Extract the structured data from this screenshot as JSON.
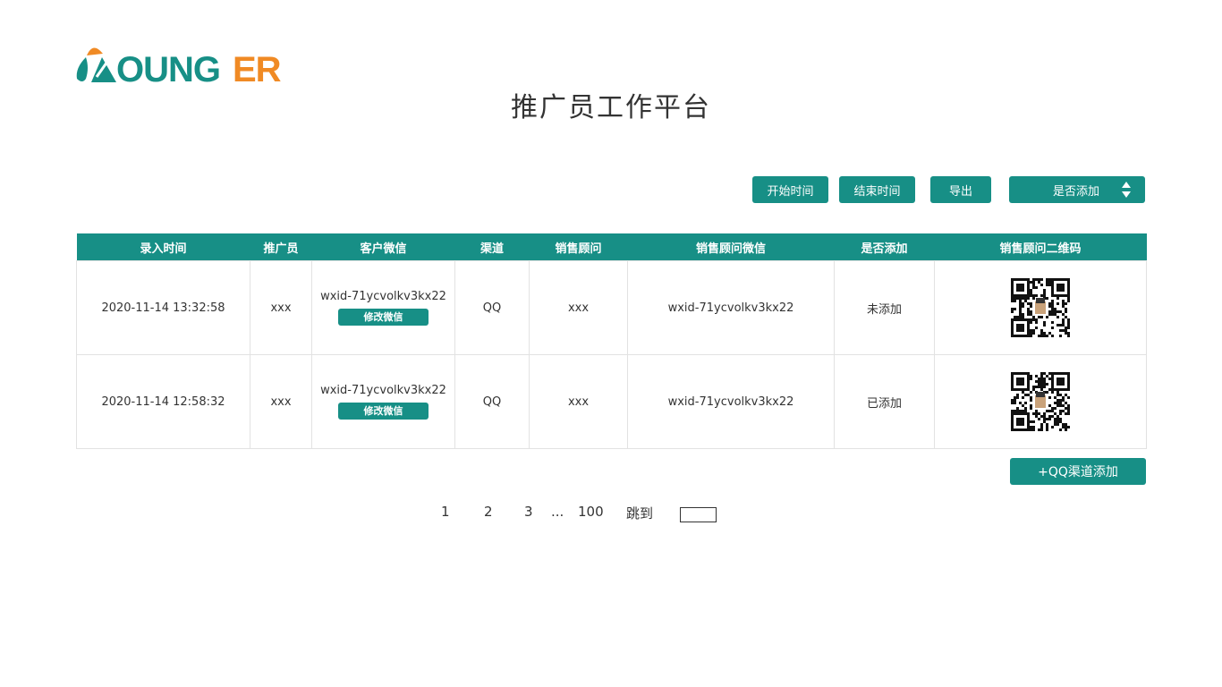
{
  "brand": {
    "logo_text": "OUNGER",
    "teal": "#178f86",
    "orange": "#f08a24"
  },
  "page_title": "推广员工作平台",
  "toolbar": {
    "start_time": "开始时间",
    "end_time": "结束时间",
    "export": "导出",
    "added_filter": "是否添加"
  },
  "table": {
    "headers": [
      "录入时间",
      "推广员",
      "客户微信",
      "渠道",
      "销售顾问",
      "销售顾问微信",
      "是否添加",
      "销售顾问二维码"
    ],
    "edit_label": "修改微信",
    "rows": [
      {
        "time": "2020-11-14   13:32:58",
        "promoter": "xxx",
        "customer_wechat": "wxid-71ycvolkv3kx22",
        "channel": "QQ",
        "advisor": "xxx",
        "advisor_wechat": "wxid-71ycvolkv3kx22",
        "added": "未添加"
      },
      {
        "time": "2020-11-14   12:58:32",
        "promoter": "xxx",
        "customer_wechat": "wxid-71ycvolkv3kx22",
        "channel": "QQ",
        "advisor": "xxx",
        "advisor_wechat": "wxid-71ycvolkv3kx22",
        "added": "已添加"
      }
    ]
  },
  "add_qq_button": "+QQ渠道添加",
  "pagination": {
    "pages": [
      "1",
      "2",
      "3"
    ],
    "ellipsis": "...",
    "last": "100",
    "jump_label": "跳到",
    "jump_value": ""
  }
}
